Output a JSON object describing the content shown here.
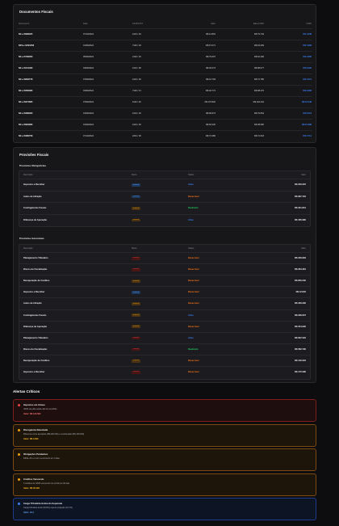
{
  "documents": {
    "title": "Documentos Fiscais",
    "headers": {
      "doc": "Documento",
      "date": "Data",
      "cfop": "CFOP/CST",
      "valor": "Valor",
      "base": "Base ICMS",
      "icms": "ICMS"
    },
    "rows": [
      {
        "doc": "NF-e 6/989025",
        "date": "07/10/2024",
        "cfop": "1201 / 40",
        "valor": "R$ 12.891",
        "base": "R$ 79.742",
        "icms": "R$ 1.848"
      },
      {
        "doc": "NFS-e 6/294458",
        "date": "01/09/2024",
        "cfop": "7102 / 20",
        "valor": "R$ 67.071",
        "base": "R$ 63.309",
        "icms": "R$ 7.983"
      },
      {
        "doc": "NF-e 6/799003",
        "date": "05/09/2024",
        "cfop": "2102 / 20",
        "valor": "R$ 79.607",
        "base": "R$ 62.296",
        "icms": "R$ 4.805"
      },
      {
        "doc": "NF-e 6/441460",
        "date": "03/09/2024",
        "cfop": "1201 / 90",
        "valor": "R$ 40.073",
        "base": "R$ 98.077",
        "icms": "R$ 9.029"
      },
      {
        "doc": "NF-e 6/832778",
        "date": "07/09/2024",
        "cfop": "1201 / 20",
        "valor": "R$ 16.793",
        "base": "R$ 72.786",
        "icms": "R$ 4.074"
      },
      {
        "doc": "NF-e 6/269380",
        "date": "03/09/2024",
        "cfop": "7102 / 41",
        "valor": "R$ 46.773",
        "base": "R$ 98.476",
        "icms": "R$ 3.983"
      },
      {
        "doc": "NF-e 6/274685",
        "date": "07/09/2024",
        "cfop": "1102 / 40",
        "valor": "R$ 176.820",
        "base": "R$ 102.234",
        "icms": "R$ 16.548"
      },
      {
        "doc": "NF-e 6/386923",
        "date": "01/09/2024",
        "cfop": "1201 / 20",
        "valor": "R$ 99.973",
        "base": "R$ 79.664",
        "icms": "R$ 9.013"
      },
      {
        "doc": "NF-e 6/984980",
        "date": "01/09/2024",
        "cfop": "1201 / 20",
        "valor": "R$ 93.320",
        "base": "R$ 38.080",
        "icms": "R$ 10.988"
      },
      {
        "doc": "NF-e 6/380708",
        "date": "07/10/2024",
        "cfop": "2201 / 00",
        "valor": "R$ 74.380",
        "base": "R$ 72.618",
        "icms": "R$ 3.714"
      }
    ]
  },
  "provisions": {
    "title": "Provisões Fiscais",
    "mandatory": {
      "title": "Provisões Obrigatórias",
      "headers": {
        "desc": "Descrição",
        "tipo": "Risco",
        "status": "Status",
        "valor": "Valor"
      },
      "rows": [
        {
          "desc": "Impostos a Recolher",
          "tipo": "mensal",
          "badge": "blue",
          "status": "Ativo",
          "st": "blue",
          "valor": "R$ 200.087"
        },
        {
          "desc": "Autos de Infração",
          "tipo": "mensal",
          "badge": "blue",
          "status": "Reversível",
          "st": "orange",
          "valor": "R$ 687.720"
        },
        {
          "desc": "Contingências Fiscais",
          "tipo": "mensal",
          "badge": "orange",
          "status": "Realizado",
          "st": "green",
          "valor": "R$ 321.831"
        },
        {
          "desc": "Diferença de Apuração",
          "tipo": "mensal",
          "badge": "orange",
          "status": "Ativo",
          "st": "blue",
          "valor": "R$ 465.980"
        }
      ]
    },
    "managerial": {
      "title": "Provisões Gerenciais",
      "headers": {
        "desc": "Descrição",
        "tipo": "Risco",
        "status": "Status",
        "valor": "Valor"
      },
      "rows": [
        {
          "desc": "Planejamento Tributário",
          "tipo": "mensal",
          "badge": "red",
          "status": "Reversível",
          "st": "orange",
          "valor": "R$ 229.962"
        },
        {
          "desc": "Riscos de Fiscalização",
          "tipo": "mensal",
          "badge": "red",
          "status": "Reversível",
          "st": "orange",
          "valor": "R$ 284.381"
        },
        {
          "desc": "Recuperação de Créditos",
          "tipo": "mensal",
          "badge": "orange",
          "status": "Reversível",
          "st": "orange",
          "valor": "R$ 850.230"
        },
        {
          "desc": "Impostos a Recolher",
          "tipo": "mensal",
          "badge": "blue",
          "status": "Reversível",
          "st": "orange",
          "valor": "R$ 12.840"
        },
        {
          "desc": "Autos de Infração",
          "tipo": "mensal",
          "badge": "orange",
          "status": "Reversível",
          "st": "orange",
          "valor": "R$ 326.390"
        },
        {
          "desc": "Contingências Fiscais",
          "tipo": "mensal",
          "badge": "orange",
          "status": "Ativo",
          "st": "blue",
          "valor": "R$ 296.607"
        },
        {
          "desc": "Diferença de Apuração",
          "tipo": "mensal",
          "badge": "orange",
          "status": "Reversível",
          "st": "orange",
          "valor": "R$ 354.990"
        },
        {
          "desc": "Planejamento Tributário",
          "tipo": "mensal",
          "badge": "red",
          "status": "Ativo",
          "st": "blue",
          "valor": "R$ 697.020"
        },
        {
          "desc": "Riscos de Fiscalização",
          "tipo": "mensal",
          "badge": "red",
          "status": "Realizado",
          "st": "green",
          "valor": "R$ 582.790"
        },
        {
          "desc": "Recuperação de Créditos",
          "tipo": "mensal",
          "badge": "orange",
          "status": "Reversível",
          "st": "orange",
          "valor": "R$ 146.022"
        },
        {
          "desc": "Impostos a Recolher",
          "tipo": "mensal",
          "badge": "red",
          "status": "Reversível",
          "st": "orange",
          "valor": "R$ 175.080"
        }
      ]
    }
  },
  "alerts": {
    "title": "Alertas Críticos",
    "items": [
      {
        "title": "Impostos em Atraso",
        "desc": "ICMS de julho ainda não foi recolhido",
        "value": "Valor: R$ 120.000",
        "kind": "red"
      },
      {
        "title": "Divergência Detectada",
        "desc": "Diferença entre apuração (R$ 290.000) e escrituração (R$ 248.000)",
        "value": "Valor: R$ 3.600",
        "kind": "orange"
      },
      {
        "title": "Obrigações Pendentes",
        "desc": "DIFAL-Pro el com vencimento em 3 dias",
        "value": "",
        "kind": "orange"
      },
      {
        "title": "Créditos Vencendo",
        "desc": "3 créditos de ICMS vencendo nos próximos 30 dias",
        "value": "Valor: R$ 35.000",
        "kind": "orange"
      },
      {
        "title": "Carga Tributária Acima do Esperado",
        "desc": "Carga tributária atual (18,8%) supera projeção (16,7%)",
        "value": "Valor: 18,1",
        "kind": "blue"
      }
    ]
  }
}
